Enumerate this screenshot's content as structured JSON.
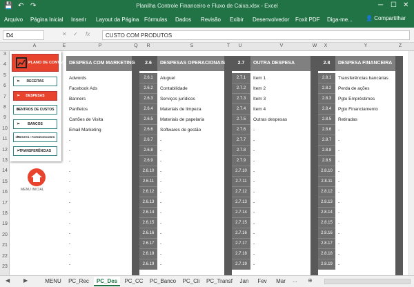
{
  "window": {
    "title": "Planilha Controle Financeiro e Fluxo de Caixa.xlsx - Excel",
    "controls": [
      "─",
      "☐",
      "✕"
    ]
  },
  "quick_access": {
    "save": "💾",
    "undo": "↶",
    "redo": "↷"
  },
  "ribbon": {
    "tabs": [
      "Arquivo",
      "Página Inicial",
      "Inserir",
      "Layout da Página",
      "Fórmulas",
      "Dados",
      "Revisão",
      "Exibir",
      "Desenvolvedor",
      "Foxit PDF",
      "Diga-me..."
    ],
    "share_label": "Compartilhar"
  },
  "formula_bar": {
    "name_box": "D4",
    "cancel": "✕",
    "enter": "✓",
    "fx": "fx",
    "content": "CUSTO COM PRODUTOS"
  },
  "columns": [
    "A",
    "E",
    "P",
    "Q",
    "R",
    "S",
    "T",
    "U",
    "V",
    "W",
    "X",
    "Y",
    "Z"
  ],
  "rows": [
    "3",
    "4",
    "5",
    "6",
    "7",
    "8",
    "9",
    "10",
    "11",
    "12",
    "13",
    "14",
    "15",
    "16",
    "17",
    "18",
    "19",
    "20",
    "21",
    "22",
    "23"
  ],
  "sidebar": {
    "plano_label": "PLANO DE CONTAS",
    "buttons": [
      "RECEITAS",
      "DESPESAS",
      "CENTROS DE CUSTOS",
      "BANCOS",
      "CLIENTES / FORNECEDORES",
      "TRANSFERÊNCIAS"
    ],
    "active": "DESPESAS",
    "menu_label": "MENU INICIAL"
  },
  "tables": [
    {
      "code": "",
      "title": "DESPESA COM MARKETING",
      "items": [
        "Adwords",
        "Facebook Ads",
        "Banners",
        "Panfletos",
        "Cartões de Visita",
        "Email Marketing",
        "-",
        "-",
        "-",
        "-",
        "-",
        "-",
        "-",
        "-",
        "-",
        "-",
        "-",
        "-",
        "-"
      ]
    },
    {
      "code": "2.6",
      "title": "DESPESAS OPERACIONAIS",
      "codes": [
        "2.6.1",
        "2.6.2",
        "2.6.3",
        "2.6.4",
        "2.6.5",
        "2.6.6",
        "2.6.7",
        "2.6.8",
        "2.6.9",
        "2.6.10",
        "2.6.11",
        "2.6.12",
        "2.6.13",
        "2.6.14",
        "2.6.15",
        "2.6.16",
        "2.6.17",
        "2.6.18",
        "2.6.19"
      ],
      "items": [
        "Aluguel",
        "Contabilidade",
        "Serviços jurídicos",
        "Materiais de limpeza",
        "Materiais de papelaria",
        "Softwares de gestão",
        "-",
        "-",
        "-",
        "-",
        "-",
        "-",
        "-",
        "-",
        "-",
        "-",
        "-",
        "-",
        "-"
      ]
    },
    {
      "code": "2.7",
      "title": "OUTRA DESPESA",
      "codes": [
        "2.7.1",
        "2.7.2",
        "2.7.3",
        "2.7.4",
        "2.7.5",
        "2.7.6",
        "2.7.7",
        "2.7.8",
        "2.7.9",
        "2.7.10",
        "2.7.11",
        "2.7.12",
        "2.7.13",
        "2.7.14",
        "2.7.15",
        "2.7.16",
        "2.7.17",
        "2.7.18",
        "2.7.19"
      ],
      "items": [
        "Item 1",
        "Item 2",
        "Item 3",
        "Item 4",
        "Outras despesas",
        "-",
        "-",
        "-",
        "-",
        "-",
        "-",
        "-",
        "-",
        "-",
        "-",
        "-",
        "-",
        "-",
        "-"
      ]
    },
    {
      "code": "2.8",
      "title": "DESPESA FINANCEIRA",
      "codes": [
        "2.8.1",
        "2.8.2",
        "2.8.3",
        "2.8.4",
        "2.8.5",
        "2.8.6",
        "2.8.7",
        "2.8.8",
        "2.8.9",
        "2.8.10",
        "2.8.11",
        "2.8.12",
        "2.8.13",
        "2.8.14",
        "2.8.15",
        "2.8.16",
        "2.8.17",
        "2.8.18",
        "2.8.19"
      ],
      "items": [
        "Transferências bancárias",
        "Perda de ações",
        "Pgto Empréstimos",
        "Pgto Financiamento",
        "Retiradas",
        "-",
        "-",
        "-",
        "-",
        "-",
        "-",
        "-",
        "-",
        "-",
        "-",
        "-",
        "-",
        "-",
        "-"
      ]
    }
  ],
  "sheet_tabs": [
    "MENU",
    "PC_Rec",
    "PC_Des",
    "PC_CC",
    "PC_Banco",
    "PC_Cli",
    "PC_Transf",
    "Jan",
    "Fev",
    "Mar"
  ],
  "active_sheet": "PC_Des",
  "sheet_nav": {
    "prev": "◀",
    "next": "▶",
    "more": "...",
    "add": "⊕"
  }
}
